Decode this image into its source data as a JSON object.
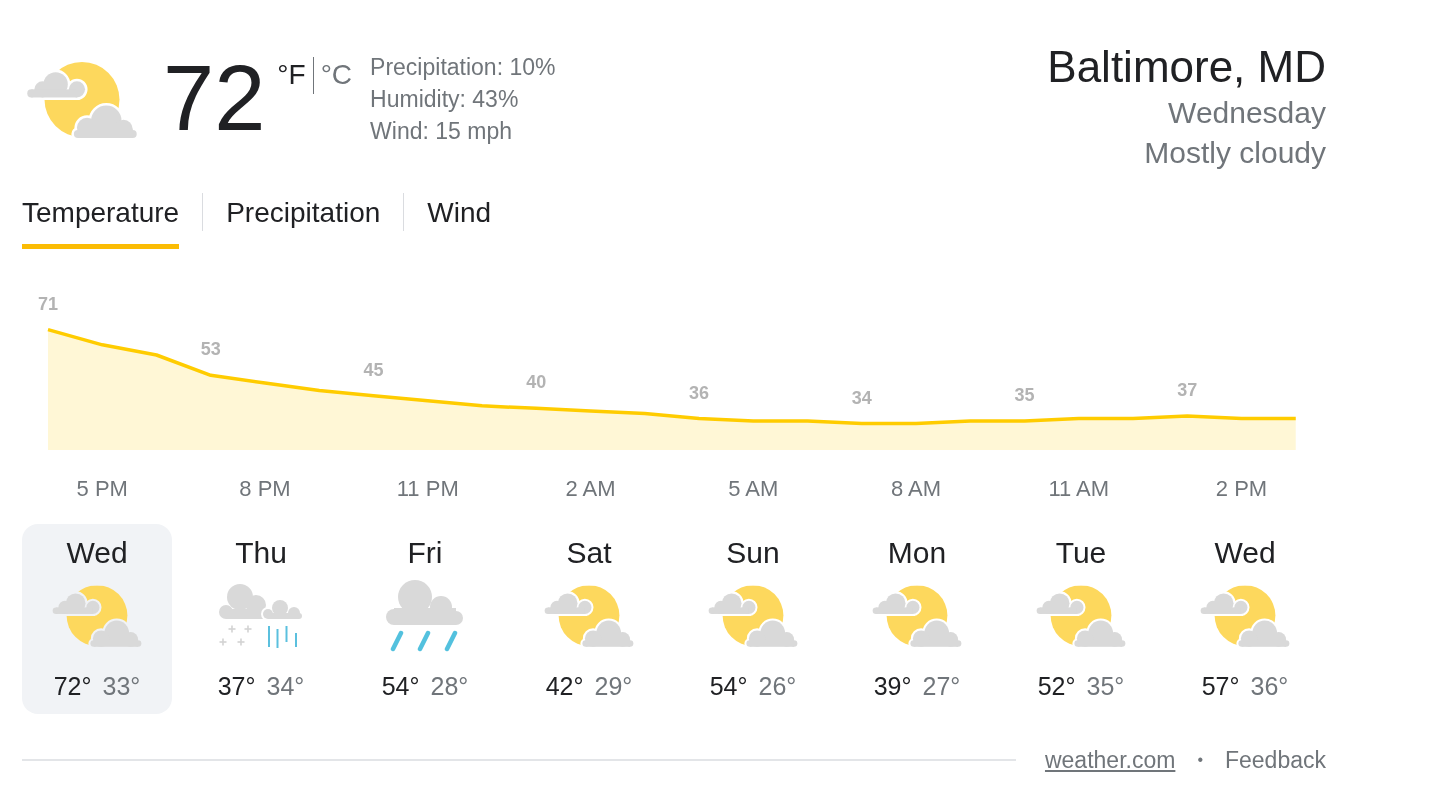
{
  "current": {
    "kind": "partlycloudy",
    "temperature": "72",
    "units": [
      {
        "label": "°F",
        "selected": true
      },
      {
        "label": "°C",
        "selected": false
      }
    ],
    "details": [
      "Precipitation: 10%",
      "Humidity: 43%",
      "Wind: 15 mph"
    ]
  },
  "location": {
    "place": "Baltimore, MD",
    "day": "Wednesday",
    "condition": "Mostly cloudy"
  },
  "tabs": [
    {
      "label": "Temperature",
      "selected": true
    },
    {
      "label": "Precipitation",
      "selected": false
    },
    {
      "label": "Wind",
      "selected": false
    }
  ],
  "chart": {
    "chart_data": [
      {
        "type": "area",
        "categories": [
          null,
          "5 PM",
          null,
          null,
          "8 PM",
          null,
          null,
          "11 PM",
          null,
          null,
          "2 AM",
          null,
          null,
          "5 AM",
          null,
          null,
          "8 AM",
          null,
          null,
          "11 AM",
          null,
          null,
          "2 PM",
          null
        ],
        "values": [
          71,
          65,
          61,
          53,
          50,
          47,
          45,
          43,
          41,
          40,
          39,
          38,
          36,
          35,
          35,
          34,
          34,
          35,
          35,
          36,
          36,
          37,
          36,
          36
        ],
        "value_labels": [
          "71",
          null,
          null,
          "53",
          null,
          null,
          "45",
          null,
          null,
          "40",
          null,
          null,
          "36",
          null,
          null,
          "34",
          null,
          null,
          "35",
          null,
          null,
          "37",
          null,
          null
        ],
        "color": "#ffcc00",
        "tick_labels": "x"
      }
    ]
  },
  "days": [
    {
      "day": "Wed",
      "kind": "partlycloudy",
      "high": "72°",
      "low": "33°",
      "selected": true
    },
    {
      "day": "Thu",
      "kind": "mix",
      "high": "37°",
      "low": "34°",
      "selected": false
    },
    {
      "day": "Fri",
      "kind": "rain",
      "high": "54°",
      "low": "28°",
      "selected": false
    },
    {
      "day": "Sat",
      "kind": "partlycloudy",
      "high": "42°",
      "low": "29°",
      "selected": false
    },
    {
      "day": "Sun",
      "kind": "partlycloudy",
      "high": "54°",
      "low": "26°",
      "selected": false
    },
    {
      "day": "Mon",
      "kind": "partlycloudy",
      "high": "39°",
      "low": "27°",
      "selected": false
    },
    {
      "day": "Tue",
      "kind": "partlycloudy",
      "high": "52°",
      "low": "35°",
      "selected": false
    },
    {
      "day": "Wed",
      "kind": "partlycloudy",
      "high": "57°",
      "low": "36°",
      "selected": false
    }
  ],
  "footer": {
    "source": "weather.com",
    "separator": "•",
    "feedback": "Feedback"
  }
}
